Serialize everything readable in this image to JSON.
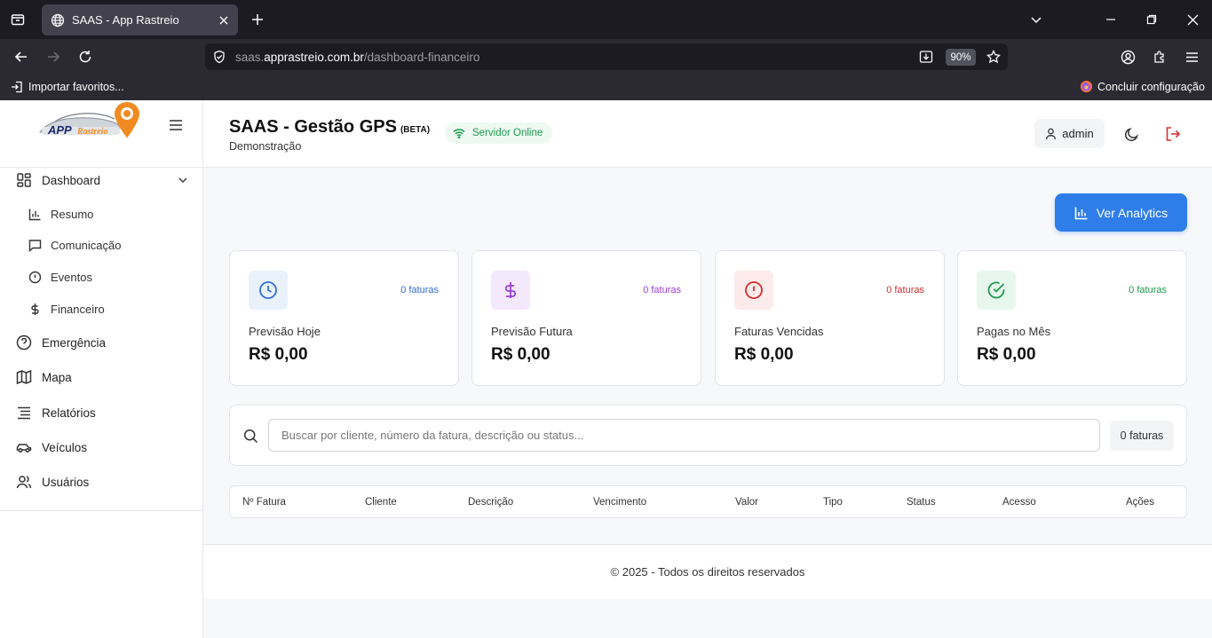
{
  "browser": {
    "tab_title": "SAAS - App Rastreio",
    "url_prefix": "saas.",
    "url_host": "apprastreio.com.br",
    "url_path": "/dashboard-financeiro",
    "zoom": "90%",
    "bookmark_import": "Importar favoritos...",
    "bookmark_setup": "Concluir configuração"
  },
  "brand": {
    "logo_text_main": "APP",
    "logo_text_sub": "Rastreio"
  },
  "sidebar": {
    "items": [
      {
        "label": "Dashboard",
        "icon": "dashboard-icon"
      },
      {
        "label": "Resumo",
        "icon": "bar-chart-icon"
      },
      {
        "label": "Comunicação",
        "icon": "message-icon"
      },
      {
        "label": "Eventos",
        "icon": "alert-circle-icon"
      },
      {
        "label": "Financeiro",
        "icon": "dollar-icon"
      },
      {
        "label": "Emergência",
        "icon": "help-circle-icon"
      },
      {
        "label": "Mapa",
        "icon": "map-icon"
      },
      {
        "label": "Relatórios",
        "icon": "list-icon"
      },
      {
        "label": "Veículos",
        "icon": "car-icon"
      },
      {
        "label": "Usuários",
        "icon": "users-icon"
      }
    ]
  },
  "header": {
    "title": "SAAS - Gestão GPS",
    "beta": "(BETA)",
    "subtitle": "Demonstração",
    "status": "Servidor Online",
    "user": "admin"
  },
  "main": {
    "analytics_button": "Ver Analytics",
    "cards": [
      {
        "count": "0 faturas",
        "label": "Previsão Hoje",
        "value": "R$ 0,00",
        "color": "#2f6fd6",
        "bg": "#e9f1fd"
      },
      {
        "count": "0 faturas",
        "label": "Previsão Futura",
        "value": "R$ 0,00",
        "color": "#9b3fd8",
        "bg": "#f3e8fc"
      },
      {
        "count": "0 faturas",
        "label": "Faturas Vencidas",
        "value": "R$ 0,00",
        "color": "#d42f2f",
        "bg": "#fdeaea"
      },
      {
        "count": "0 faturas",
        "label": "Pagas no Mês",
        "value": "R$ 0,00",
        "color": "#1f9a4d",
        "bg": "#e8f7ee"
      }
    ],
    "search_placeholder": "Buscar por cliente, número da fatura, descrição ou status...",
    "search_count": "0 faturas",
    "table_columns": [
      "Nº Fatura",
      "Cliente",
      "Descrição",
      "Vencimento",
      "Valor",
      "Tipo",
      "Status",
      "Acesso",
      "Ações"
    ]
  },
  "footer": {
    "text": "© 2025 - Todos os direitos reservados"
  }
}
